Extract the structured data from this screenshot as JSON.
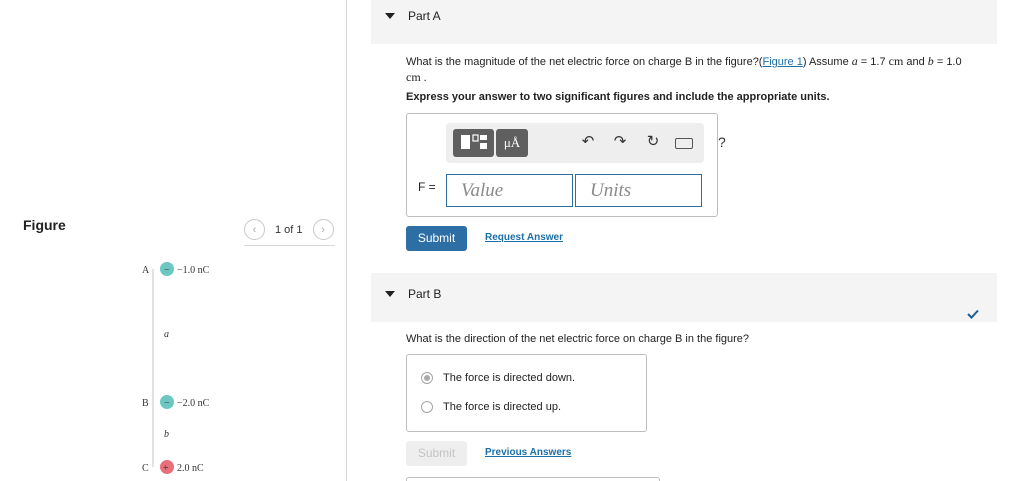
{
  "figure_panel": {
    "label": "Figure",
    "pager": {
      "text": "1 of 1",
      "prev_icon": "chevron-left-icon",
      "next_icon": "chevron-right-icon"
    },
    "charges": [
      {
        "label": "A",
        "sign": "−",
        "value": "−1.0 nC",
        "color": "#6cc7c2"
      },
      {
        "label": "B",
        "sign": "−",
        "value": "−2.0 nC",
        "color": "#6cc7c2"
      },
      {
        "label": "C",
        "sign": "+",
        "value": "2.0 nC",
        "color": "#e8707a"
      }
    ],
    "dist_a": "a",
    "dist_b": "b"
  },
  "part_a": {
    "title": "Part A",
    "question_pre": "What is the magnitude of the net electric force on charge B in the figure?(",
    "figure_link": "Figure 1",
    "question_mid": ") Assume ",
    "var_a": "a",
    "eq_a": " = 1.7 ",
    "unit_cm_1": "cm",
    "and_text": " and ",
    "var_b": "b",
    "eq_b": " = 1.0",
    "unit_cm_2": "cm .",
    "instruction": "Express your answer to two significant figures and include the appropriate units.",
    "toolbar": {
      "templates_icon": "templates-icon",
      "units_button": "μÅ",
      "undo_icon": "undo-icon",
      "redo_icon": "redo-icon",
      "reset_icon": "reset-icon",
      "keyboard_icon": "keyboard-icon",
      "help_label": "?"
    },
    "answer_label": "F =",
    "value_placeholder": "Value",
    "units_placeholder": "Units",
    "submit_label": "Submit",
    "request_answer_label": "Request Answer"
  },
  "part_b": {
    "title": "Part B",
    "status_icon": "checkmark-icon",
    "status_color": "#1e5f96",
    "question": "What is the direction of the net electric force on charge B in the figure?",
    "options": [
      {
        "label": "The force is directed down.",
        "selected": true
      },
      {
        "label": "The force is directed up.",
        "selected": false
      }
    ],
    "submit_label": "Submit",
    "previous_answers_label": "Previous Answers"
  }
}
